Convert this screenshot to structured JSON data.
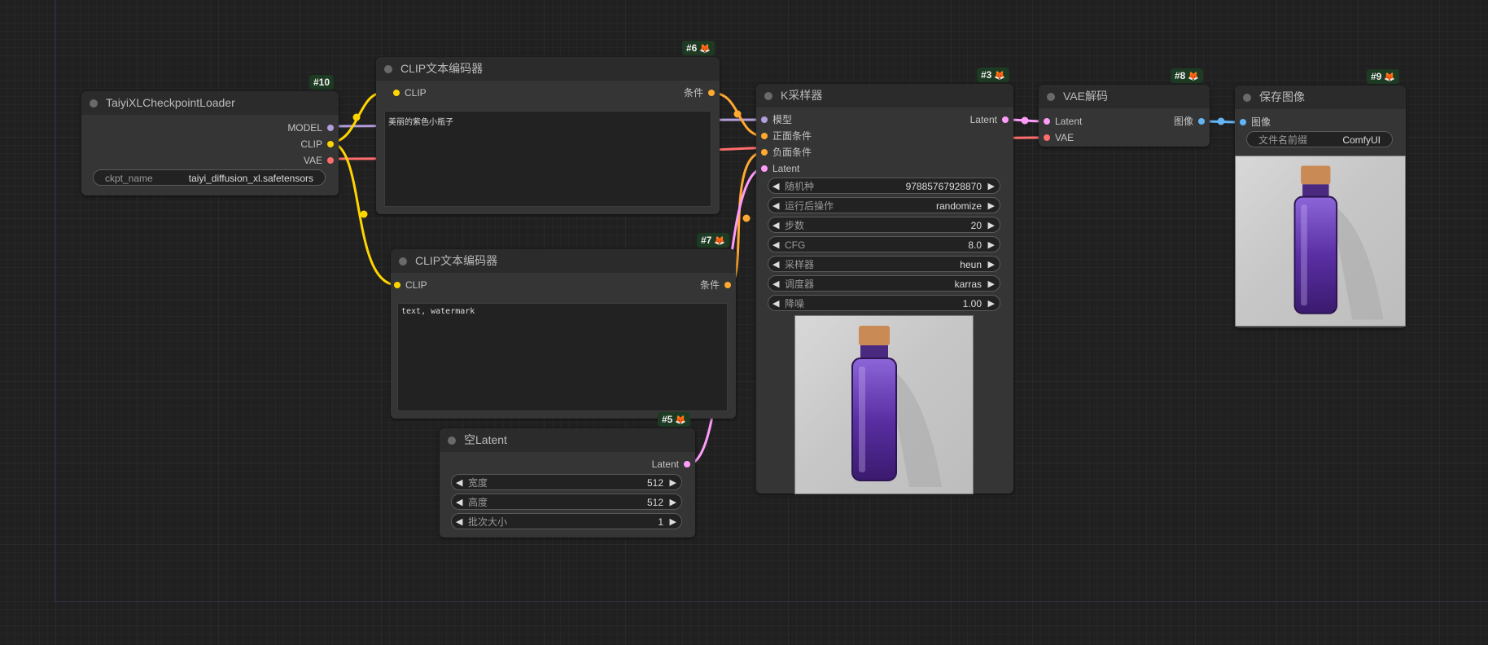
{
  "nodes": {
    "checkpoint_loader": {
      "id": "#10",
      "title": "TaiyiXLCheckpointLoader",
      "outputs": [
        "MODEL",
        "CLIP",
        "VAE"
      ],
      "widget": {
        "label": "ckpt_name",
        "value": "taiyi_diffusion_xl.safetensors"
      }
    },
    "clip_positive": {
      "id": "#6",
      "title": "CLIP文本编码器",
      "input": "CLIP",
      "output": "条件",
      "text": "美丽的紫色小瓶子"
    },
    "clip_negative": {
      "id": "#7",
      "title": "CLIP文本编码器",
      "input": "CLIP",
      "output": "条件",
      "text": "text, watermark"
    },
    "empty_latent": {
      "id": "#5",
      "title": "空Latent",
      "output": "Latent",
      "widgets": [
        {
          "label": "宽度",
          "value": "512"
        },
        {
          "label": "高度",
          "value": "512"
        },
        {
          "label": "批次大小",
          "value": "1"
        }
      ]
    },
    "ksampler": {
      "id": "#3",
      "title": "K采样器",
      "inputs": [
        "模型",
        "正面条件",
        "负面条件",
        "Latent"
      ],
      "output": "Latent",
      "widgets": [
        {
          "label": "随机种",
          "value": "97885767928870"
        },
        {
          "label": "运行后操作",
          "value": "randomize"
        },
        {
          "label": "步数",
          "value": "20"
        },
        {
          "label": "CFG",
          "value": "8.0"
        },
        {
          "label": "采样器",
          "value": "heun"
        },
        {
          "label": "调度器",
          "value": "karras"
        },
        {
          "label": "降噪",
          "value": "1.00"
        }
      ]
    },
    "vae_decode": {
      "id": "#8",
      "title": "VAE解码",
      "inputs": [
        "Latent",
        "VAE"
      ],
      "output": "图像"
    },
    "save_image": {
      "id": "#9",
      "title": "保存图像",
      "input": "图像",
      "widget": {
        "label": "文件名前缀",
        "value": "ComfyUI"
      }
    }
  },
  "icons": {
    "badge_icon": "fox-icon",
    "arrow_left": "◀",
    "arrow_right": "▶"
  },
  "colors": {
    "background": "#202020",
    "node_body": "#353535",
    "node_title": "#2b2b2b",
    "badge": "#1d3a22",
    "wire_model": "#b39ddb",
    "wire_clip": "#ffd500",
    "wire_vae": "#ff6e6e",
    "wire_conditioning": "#ffa931",
    "wire_latent": "#ff9cf9",
    "wire_image": "#64b5f6"
  }
}
